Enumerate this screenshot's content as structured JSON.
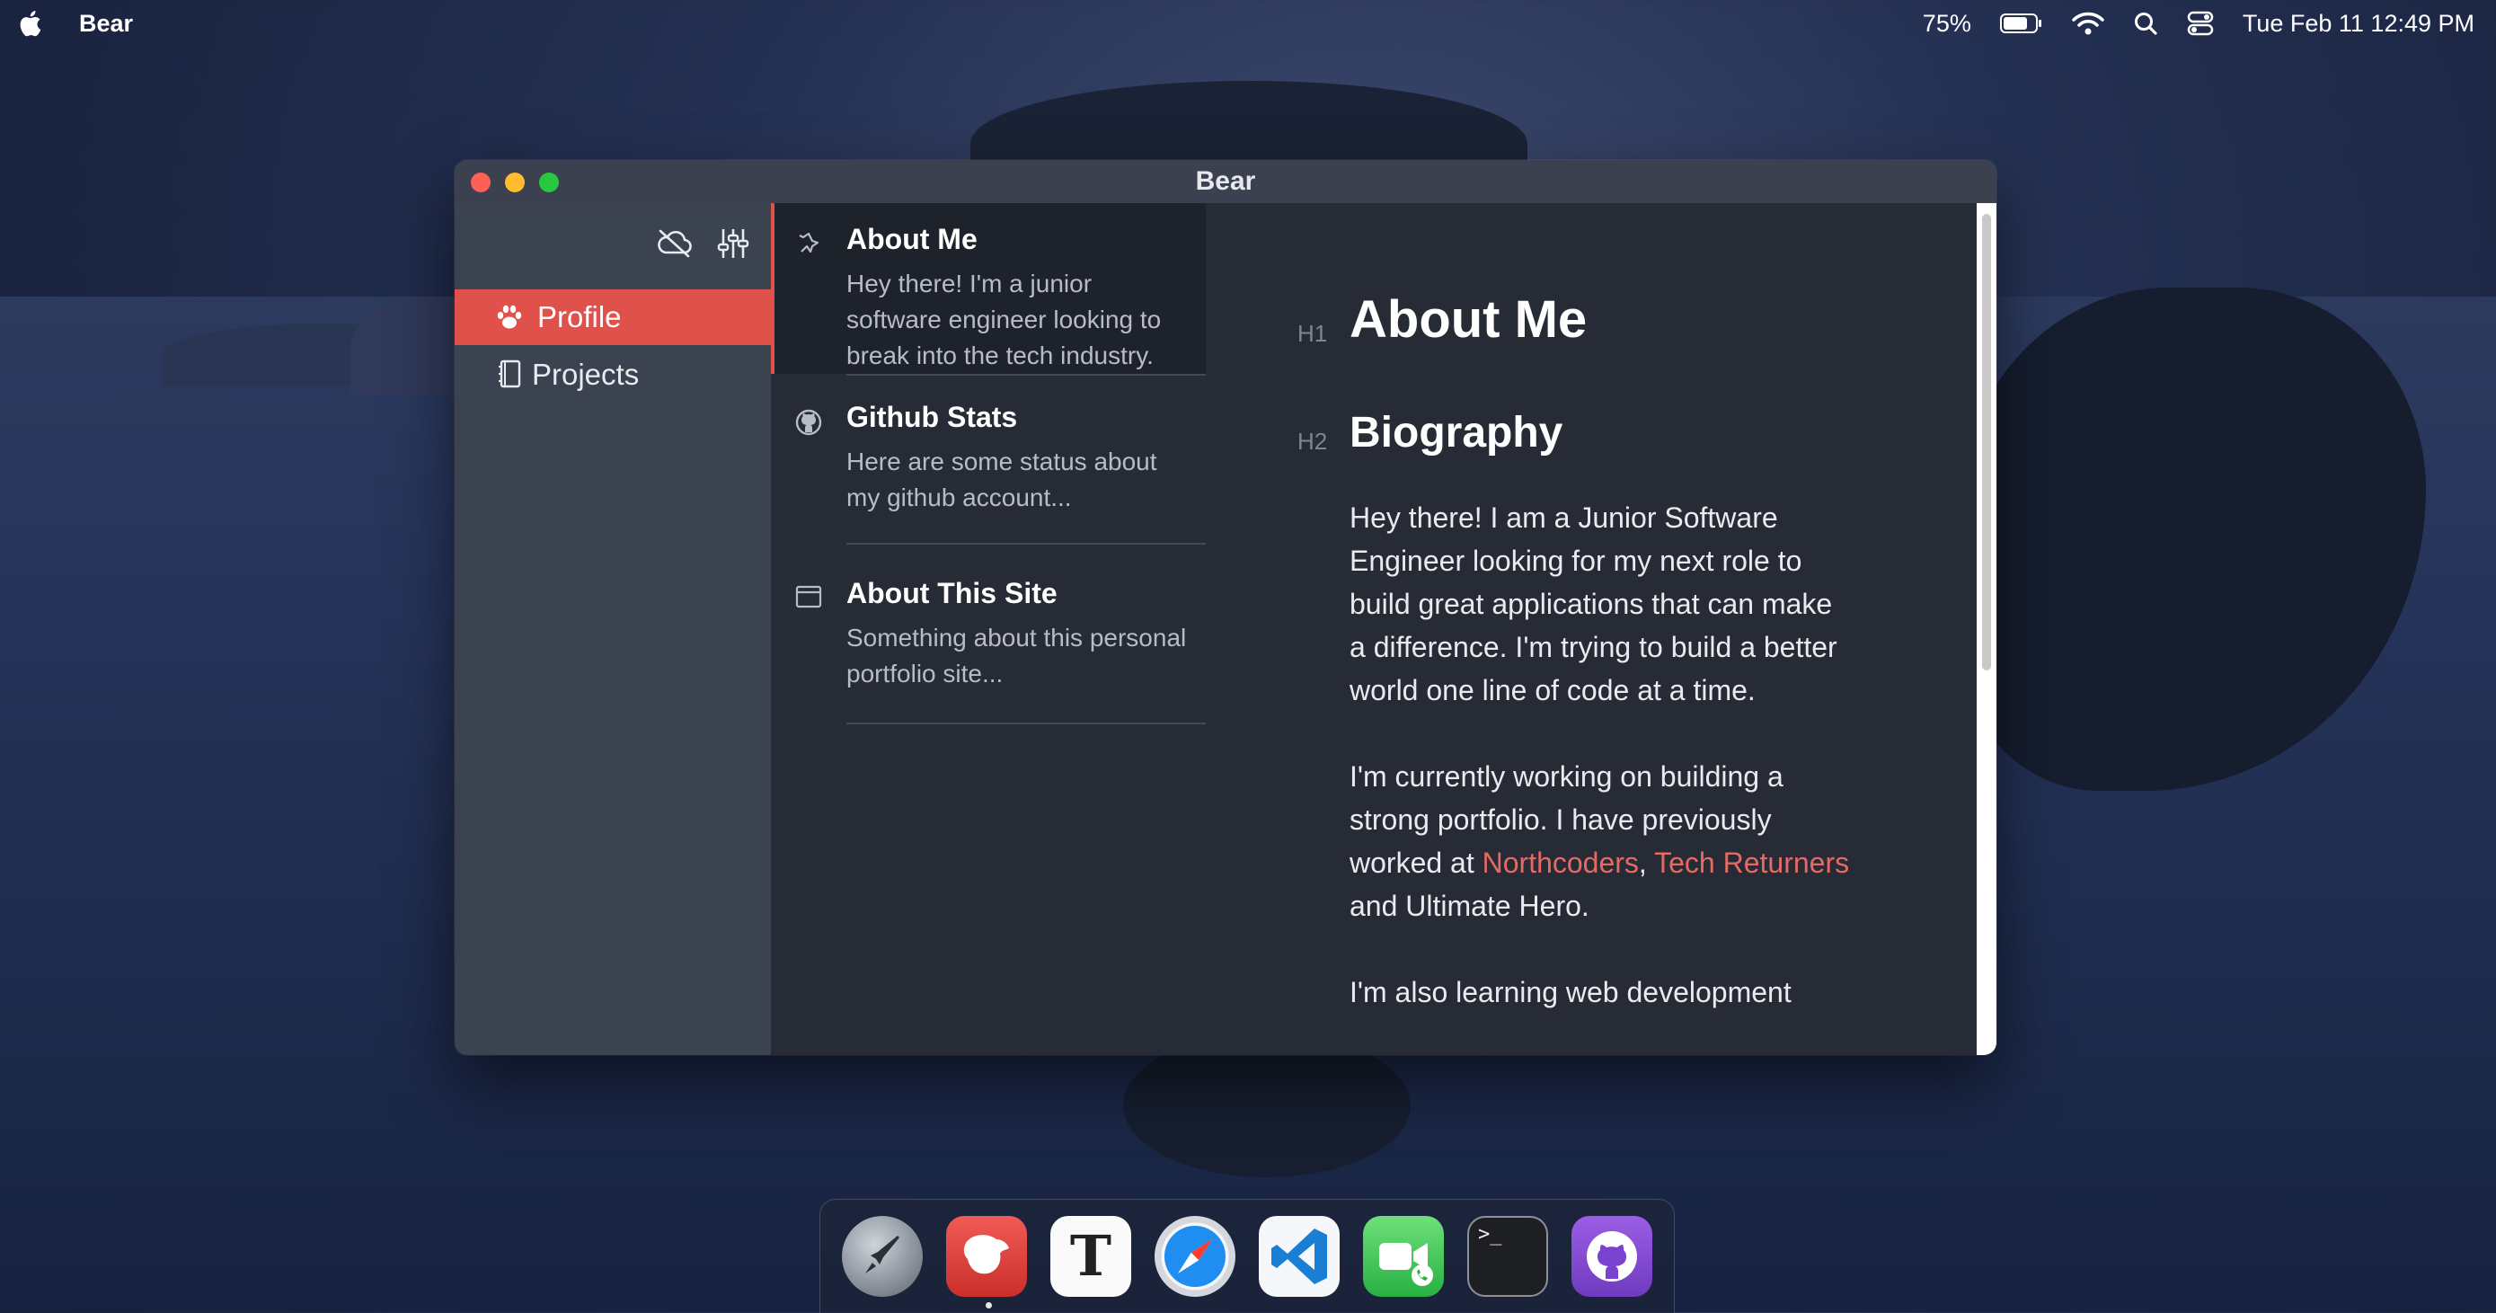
{
  "menubar": {
    "app_name": "Bear",
    "battery": "75%",
    "datetime": "Tue Feb 11  12:49 PM"
  },
  "window": {
    "title": "Bear"
  },
  "sidebar": {
    "items": [
      {
        "label": "Profile",
        "icon": "paw-icon",
        "active": true
      },
      {
        "label": "Projects",
        "icon": "notebook-icon",
        "active": false
      }
    ]
  },
  "notes": [
    {
      "title": "About Me",
      "snippet": "Hey there! I'm a junior software engineer looking to break into the tech industry.",
      "icon": "pin-icon"
    },
    {
      "title": "Github Stats",
      "snippet": "Here are some status about my github account...",
      "icon": "github-icon"
    },
    {
      "title": "About This Site",
      "snippet": "Something about this personal portfolio site...",
      "icon": "browser-window-icon"
    }
  ],
  "editor": {
    "h1_marker": "H1",
    "h1": "About Me",
    "h2_marker": "H2",
    "h2": "Biography",
    "para1": "Hey there! I am a Junior Software Engineer looking for my next role to build great applications that can make a difference. I'm trying to build a better world one line of code at a time.",
    "para2_pre": "I'm currently working on building a strong portfolio. I have previously worked at ",
    "para2_link1": "Northcoders",
    "para2_sep": ", ",
    "para2_link2": "Tech Returners",
    "para2_post": " and Ultimate Hero.",
    "para3": "I'm also learning web development"
  },
  "dock": {
    "apps": [
      "launchpad-icon",
      "bear-icon",
      "typora-icon",
      "safari-icon",
      "vscode-icon",
      "facetime-icon",
      "terminal-icon",
      "github-desktop-icon"
    ],
    "typora_glyph": "T",
    "terminal_prompt": ">_"
  },
  "colors": {
    "accent": "#e0514c",
    "link": "#e56a64"
  }
}
